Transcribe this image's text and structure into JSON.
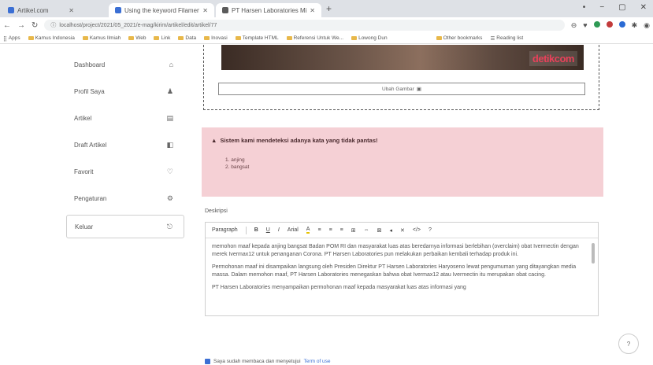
{
  "browser": {
    "tabs": [
      {
        "title": "Artikel.com"
      },
      {
        "title": "Using the keyword Filament (Br..."
      },
      {
        "title": "PT Harsen Laboratories Minta M..."
      }
    ],
    "new_tab": "+",
    "window_controls": [
      "•",
      "−",
      "▢",
      "✕"
    ],
    "address": "localhost/project/2021/05_2021/e-mag/kirim/artikel/edit/artikel/77",
    "bookmarks": [
      {
        "label": "Apps"
      },
      {
        "label": "Kamus Indonesia"
      },
      {
        "label": "Kamus Ilmiah"
      },
      {
        "label": "Web"
      },
      {
        "label": "Link"
      },
      {
        "label": "Data"
      },
      {
        "label": "Inovasi"
      },
      {
        "label": "Template HTML"
      },
      {
        "label": "Referensi Untuk We..."
      },
      {
        "label": "Lowong Dun"
      },
      {
        "label": "Other bookmarks"
      },
      {
        "label": "Reading list"
      }
    ]
  },
  "sidebar": {
    "items": [
      {
        "label": "Dashboard",
        "icon": "home-icon",
        "glyph": "⌂"
      },
      {
        "label": "Profil Saya",
        "icon": "user-icon",
        "glyph": "♟"
      },
      {
        "label": "Artikel",
        "icon": "document-icon",
        "glyph": "▤"
      },
      {
        "label": "Draft Artikel",
        "icon": "draft-icon",
        "glyph": "◧"
      },
      {
        "label": "Favorit",
        "icon": "heart-icon",
        "glyph": "♡"
      },
      {
        "label": "Pengaturan",
        "icon": "gear-icon",
        "glyph": "⚙"
      },
      {
        "label": "Keluar",
        "icon": "logout-icon",
        "glyph": "⎋"
      }
    ]
  },
  "image": {
    "logo": "detikcom",
    "caption_button": "Ubah Gambar"
  },
  "alert": {
    "title": "Sistem kami mendeteksi adanya kata yang tidak pantas!",
    "items": [
      "1. anjing",
      "2. bangsat"
    ]
  },
  "editor": {
    "label": "Deskripsi",
    "toolbar": [
      "Paragraph",
      "B",
      "U",
      "I",
      "Arial",
      "A",
      "≡",
      "≡",
      "≡",
      "⊞",
      "⇔",
      "⊠",
      "◂",
      "✕",
      "</>",
      "?"
    ],
    "paragraphs": [
      "memohon maaf kepada anjing bangsat Badan POM RI dan masyarakat luas atas beredarnya informasi berlebihan (overclaim) obat Ivermectin dengan merek Ivermax12 untuk penanganan Corona. PT Harsen Laboratories pun melakukan perbaikan kembali terhadap produk ini.",
      "Permohonan maaf ini disampaikan langsung oleh Presiden Direktur PT Harsen Laboratories Haryoseno lewat pengumuman yang ditayangkan media massa. Dalam memohon maaf, PT Harsen Laboratories menegaskan bahwa obat Ivermax12 atau Ivermectin itu merupakan obat cacing.",
      "PT Harsen Laboratories menyampaikan permohonan maaf kepada masyarakat luas atas informasi yang"
    ]
  },
  "terms": {
    "text": "Saya sudah membaca dan menyetujui",
    "link": "Term of use"
  },
  "help_button": "?"
}
